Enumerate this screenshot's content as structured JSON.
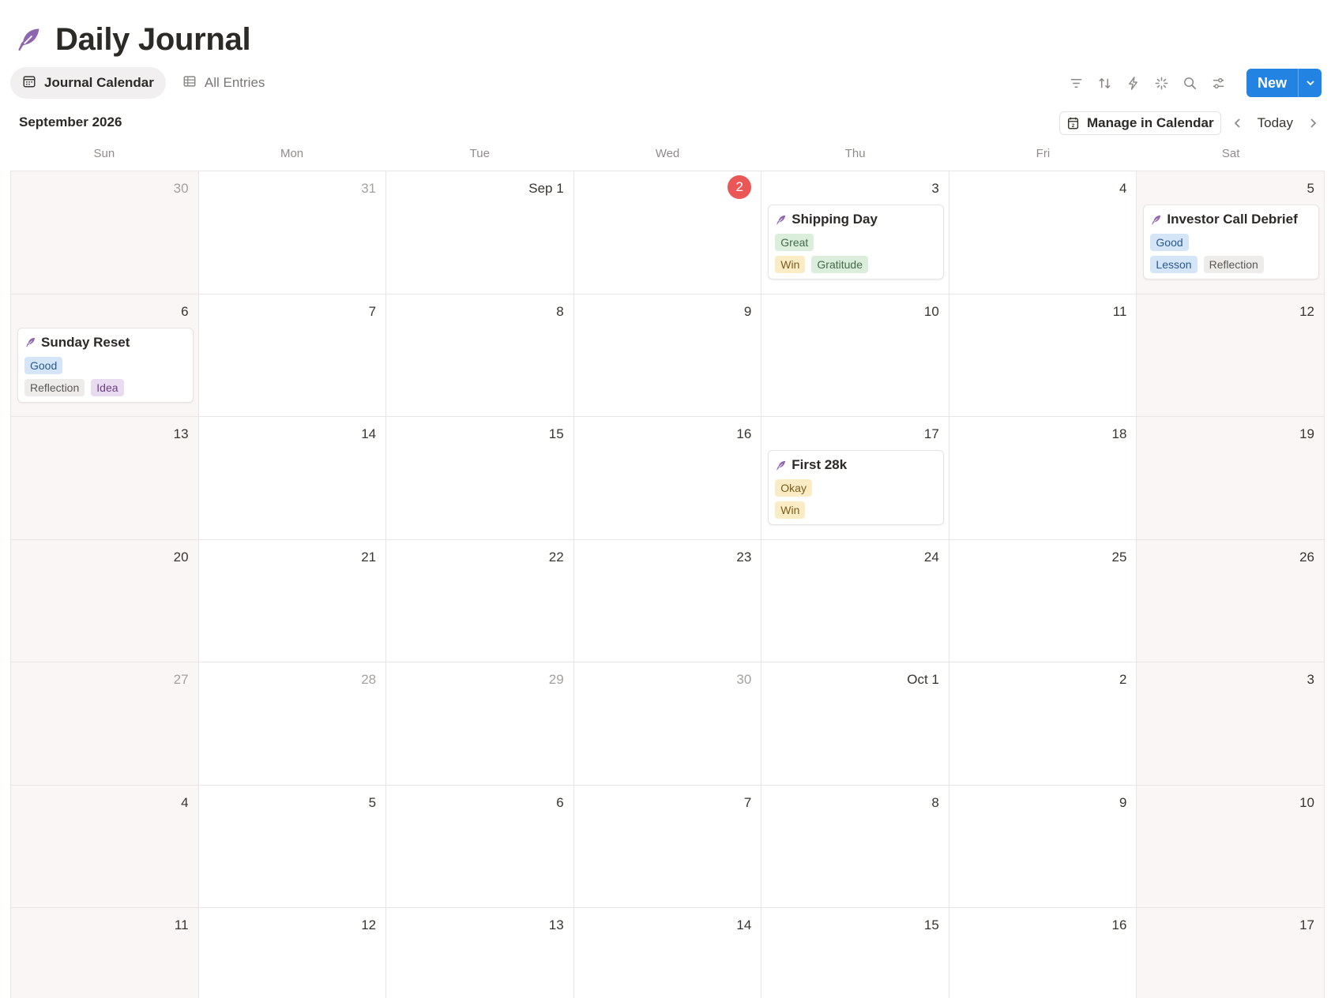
{
  "page": {
    "title": "Daily Journal",
    "icon": "feather-icon"
  },
  "tabs": [
    {
      "label": "Journal Calendar",
      "icon": "calendar-icon",
      "active": true
    },
    {
      "label": "All Entries",
      "icon": "table-icon",
      "active": false
    }
  ],
  "toolbar": {
    "icons": [
      "filter-icon",
      "sort-icon",
      "lightning-icon",
      "sparkle-icon",
      "search-icon",
      "settings-icon"
    ],
    "new_label": "New"
  },
  "calendar": {
    "month_label": "September 2026",
    "manage_label": "Manage in Calendar",
    "today_label": "Today",
    "weekdays": [
      "Sun",
      "Mon",
      "Tue",
      "Wed",
      "Thu",
      "Fri",
      "Sat"
    ],
    "weeks": [
      [
        {
          "label": "30",
          "muted": true
        },
        {
          "label": "31",
          "muted": true
        },
        {
          "label": "Sep 1"
        },
        {
          "label": "2",
          "today": true
        },
        {
          "label": "3",
          "event": 0
        },
        {
          "label": "4"
        },
        {
          "label": "5",
          "event": 1
        }
      ],
      [
        {
          "label": "6",
          "event": 2
        },
        {
          "label": "7"
        },
        {
          "label": "8"
        },
        {
          "label": "9"
        },
        {
          "label": "10"
        },
        {
          "label": "11"
        },
        {
          "label": "12"
        }
      ],
      [
        {
          "label": "13"
        },
        {
          "label": "14"
        },
        {
          "label": "15"
        },
        {
          "label": "16"
        },
        {
          "label": "17",
          "event": 3
        },
        {
          "label": "18"
        },
        {
          "label": "19"
        }
      ],
      [
        {
          "label": "20"
        },
        {
          "label": "21"
        },
        {
          "label": "22"
        },
        {
          "label": "23"
        },
        {
          "label": "24"
        },
        {
          "label": "25"
        },
        {
          "label": "26"
        }
      ],
      [
        {
          "label": "27",
          "muted": true
        },
        {
          "label": "28",
          "muted": true
        },
        {
          "label": "29",
          "muted": true
        },
        {
          "label": "30",
          "muted": true
        },
        {
          "label": "Oct 1"
        },
        {
          "label": "2"
        },
        {
          "label": "3"
        }
      ],
      [
        {
          "label": "4"
        },
        {
          "label": "5"
        },
        {
          "label": "6"
        },
        {
          "label": "7"
        },
        {
          "label": "8"
        },
        {
          "label": "9"
        },
        {
          "label": "10"
        }
      ],
      [
        {
          "label": "11"
        },
        {
          "label": "12"
        },
        {
          "label": "13"
        },
        {
          "label": "14"
        },
        {
          "label": "15"
        },
        {
          "label": "16"
        },
        {
          "label": "17"
        }
      ]
    ]
  },
  "events": [
    {
      "title": "Shipping Day",
      "mood": {
        "label": "Great",
        "bg": "#dbeddb",
        "fg": "#456b4a"
      },
      "tags": [
        {
          "label": "Win",
          "bg": "#fbecc6",
          "fg": "#7a5b1e"
        },
        {
          "label": "Gratitude",
          "bg": "#dbeddb",
          "fg": "#456b4a"
        }
      ]
    },
    {
      "title": "Investor Call Debrief",
      "mood": {
        "label": "Good",
        "bg": "#d3e5f7",
        "fg": "#2a5a8c"
      },
      "tags": [
        {
          "label": "Lesson",
          "bg": "#d3e5f7",
          "fg": "#2a5a8c"
        },
        {
          "label": "Reflection",
          "bg": "#eeeceb",
          "fg": "#5a5753"
        }
      ]
    },
    {
      "title": "Sunday Reset",
      "mood": {
        "label": "Good",
        "bg": "#d3e5f7",
        "fg": "#2a5a8c"
      },
      "tags": [
        {
          "label": "Reflection",
          "bg": "#eeeceb",
          "fg": "#5a5753"
        },
        {
          "label": "Idea",
          "bg": "#eadcf0",
          "fg": "#6b3f80"
        }
      ]
    },
    {
      "title": "First 28k",
      "mood": {
        "label": "Okay",
        "bg": "#fbecc6",
        "fg": "#7a5b1e"
      },
      "tags": [
        {
          "label": "Win",
          "bg": "#fbecc6",
          "fg": "#7a5b1e"
        }
      ]
    }
  ],
  "colors": {
    "accent": "#2383e2",
    "today": "#eb5757",
    "feather": "#9065b0"
  }
}
